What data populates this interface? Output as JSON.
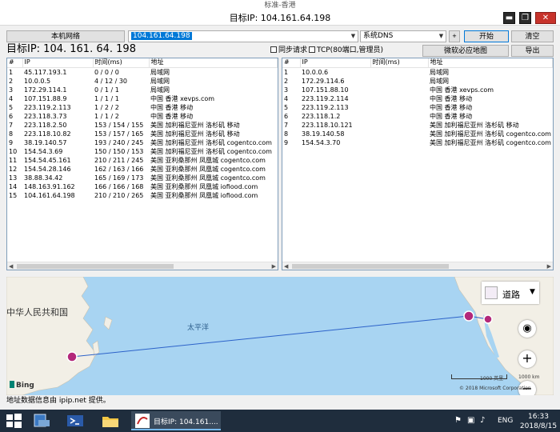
{
  "window": {
    "outer_title": "标准-香港",
    "title": "目标IP: 104.161.64.198"
  },
  "toolbar": {
    "local_network_label": "本机网络",
    "target_value": "104.161.64.198",
    "dns_value": "系统DNS",
    "plus_label": "+",
    "start_label": "开始",
    "clear_label": "清空",
    "bing_map_label": "微软必应地图",
    "export_label": "导出"
  },
  "header": {
    "target_display": "目标IP:  104. 161. 64. 198",
    "sync_label": "同步请求",
    "tcp_label": "TCP(80端口,管理员)"
  },
  "left_table": {
    "columns": [
      "#",
      "IP",
      "时间(ms)",
      "地址"
    ],
    "rows": [
      [
        "1",
        "45.117.193.1",
        "0 / 0 / 0",
        "局域网"
      ],
      [
        "2",
        "10.0.0.5",
        "4 / 12 / 30",
        "局域网"
      ],
      [
        "3",
        "172.29.114.1",
        "0 / 1 / 1",
        "局域网"
      ],
      [
        "4",
        "107.151.88.9",
        "1 / 1 / 1",
        "中国 香港 xevps.com"
      ],
      [
        "5",
        "223.119.2.113",
        "1 / 2 / 2",
        "中国 香港 移动"
      ],
      [
        "6",
        "223.118.3.73",
        "1 / 1 / 2",
        "中国 香港 移动"
      ],
      [
        "7",
        "223.118.2.50",
        "153 / 154 / 155",
        "美国 加利福尼亚州 洛杉矶 移动"
      ],
      [
        "8",
        "223.118.10.82",
        "153 / 157 / 165",
        "美国 加利福尼亚州 洛杉矶 移动"
      ],
      [
        "9",
        "38.19.140.57",
        "193 / 240 / 245",
        "美国 加利福尼亚州 洛杉矶 cogentco.com"
      ],
      [
        "10",
        "154.54.3.69",
        "150 / 150 / 153",
        "美国 加利福尼亚州 洛杉矶 cogentco.com"
      ],
      [
        "11",
        "154.54.45.161",
        "210 / 211 / 245",
        "美国 亚利桑那州 凤凰城 cogentco.com"
      ],
      [
        "12",
        "154.54.28.146",
        "162 / 163 / 166",
        "美国 亚利桑那州 凤凰城 cogentco.com"
      ],
      [
        "13",
        "38.88.34.42",
        "165 / 169 / 173",
        "美国 亚利桑那州 凤凰城 cogentco.com"
      ],
      [
        "14",
        "148.163.91.162",
        "166 / 166 / 168",
        "美国 亚利桑那州 凤凰城 iofiood.com"
      ],
      [
        "15",
        "104.161.64.198",
        "210 / 210 / 265",
        "美国 亚利桑那州 凤凰城 iofiood.com"
      ]
    ]
  },
  "right_table": {
    "columns": [
      "#",
      "IP",
      "时间(ms)",
      "地址"
    ],
    "rows": [
      [
        "1",
        "10.0.0.6",
        "",
        "局域网"
      ],
      [
        "2",
        "172.29.114.6",
        "",
        "局域网"
      ],
      [
        "3",
        "107.151.88.10",
        "",
        "中国 香港 xevps.com"
      ],
      [
        "4",
        "223.119.2.114",
        "",
        "中国 香港 移动"
      ],
      [
        "5",
        "223.119.2.113",
        "",
        "中国 香港 移动"
      ],
      [
        "6",
        "223.118.1.2",
        "",
        "中国 香港 移动"
      ],
      [
        "7",
        "223.118.10.121",
        "",
        "美国 加利福尼亚州 洛杉矶 移动"
      ],
      [
        "8",
        "38.19.140.58",
        "",
        "美国 加利福尼亚州 洛杉矶 cogentco.com"
      ],
      [
        "9",
        "154.54.3.70",
        "",
        "美国 加利福尼亚州 洛杉矶 cogentco.com"
      ]
    ]
  },
  "map": {
    "china_label": "中华人民共和国",
    "ocean_label": "太平洋",
    "roads_label": "道路",
    "bing_label": "Bing",
    "scale_left": "1000 英里",
    "scale_right": "1000 km",
    "copyright": "© 2018 Microsoft Corporation",
    "route_color": "#2c62c9",
    "marker_color": "#b3287a"
  },
  "footer": {
    "source_label": "地址数据信息由 ipip.net 提供。"
  },
  "taskbar": {
    "app_label": "目标IP: 104.161....",
    "lang": "ENG",
    "time": "16:33",
    "date": "2018/8/15"
  }
}
